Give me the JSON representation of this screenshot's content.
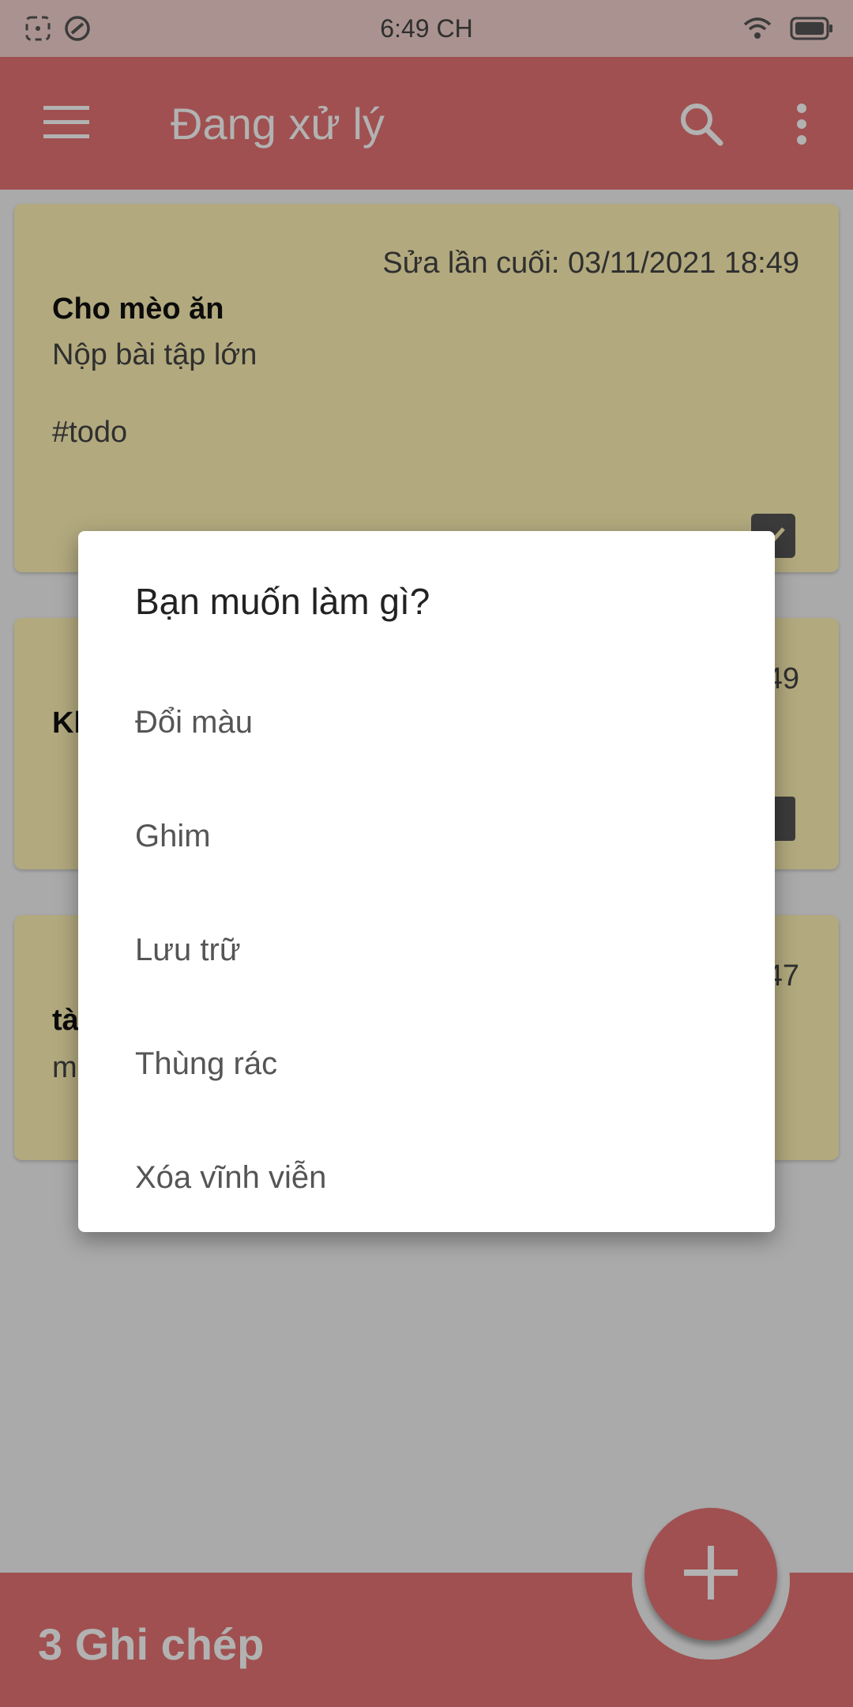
{
  "status_bar": {
    "time": "6:49 CH",
    "icons": [
      "screenshot-icon",
      "vpn-icon",
      "wifi-icon",
      "battery-icon"
    ]
  },
  "toolbar": {
    "title": "Đang xử lý",
    "icons": [
      "menu-icon",
      "search-icon",
      "more-vert-icon"
    ]
  },
  "notes": [
    {
      "date": "Sửa lần cuối: 03/11/2021 18:49",
      "title": "Cho mèo ăn",
      "body": "Nộp bài tập lớn",
      "tag": "#todo",
      "icon": "checkbox-icon"
    },
    {
      "date_fragment": "49",
      "title_fragment": "Kh",
      "icon": "image-icon"
    },
    {
      "date_fragment": "47",
      "title_fragment": "tà",
      "body_fragment": "m"
    }
  ],
  "bottom_bar": {
    "count": "3 Ghi chép"
  },
  "fab": {
    "icon": "plus-icon"
  },
  "dialog": {
    "title": "Bạn muốn làm gì?",
    "items": [
      "Đổi màu",
      "Ghim",
      "Lưu trữ",
      "Thùng rác",
      "Xóa vĩnh viễn"
    ]
  },
  "colors": {
    "primary": "#e57373",
    "note_background": "#fff3b5",
    "scrim": "rgba(0,0,0,0.30)"
  }
}
